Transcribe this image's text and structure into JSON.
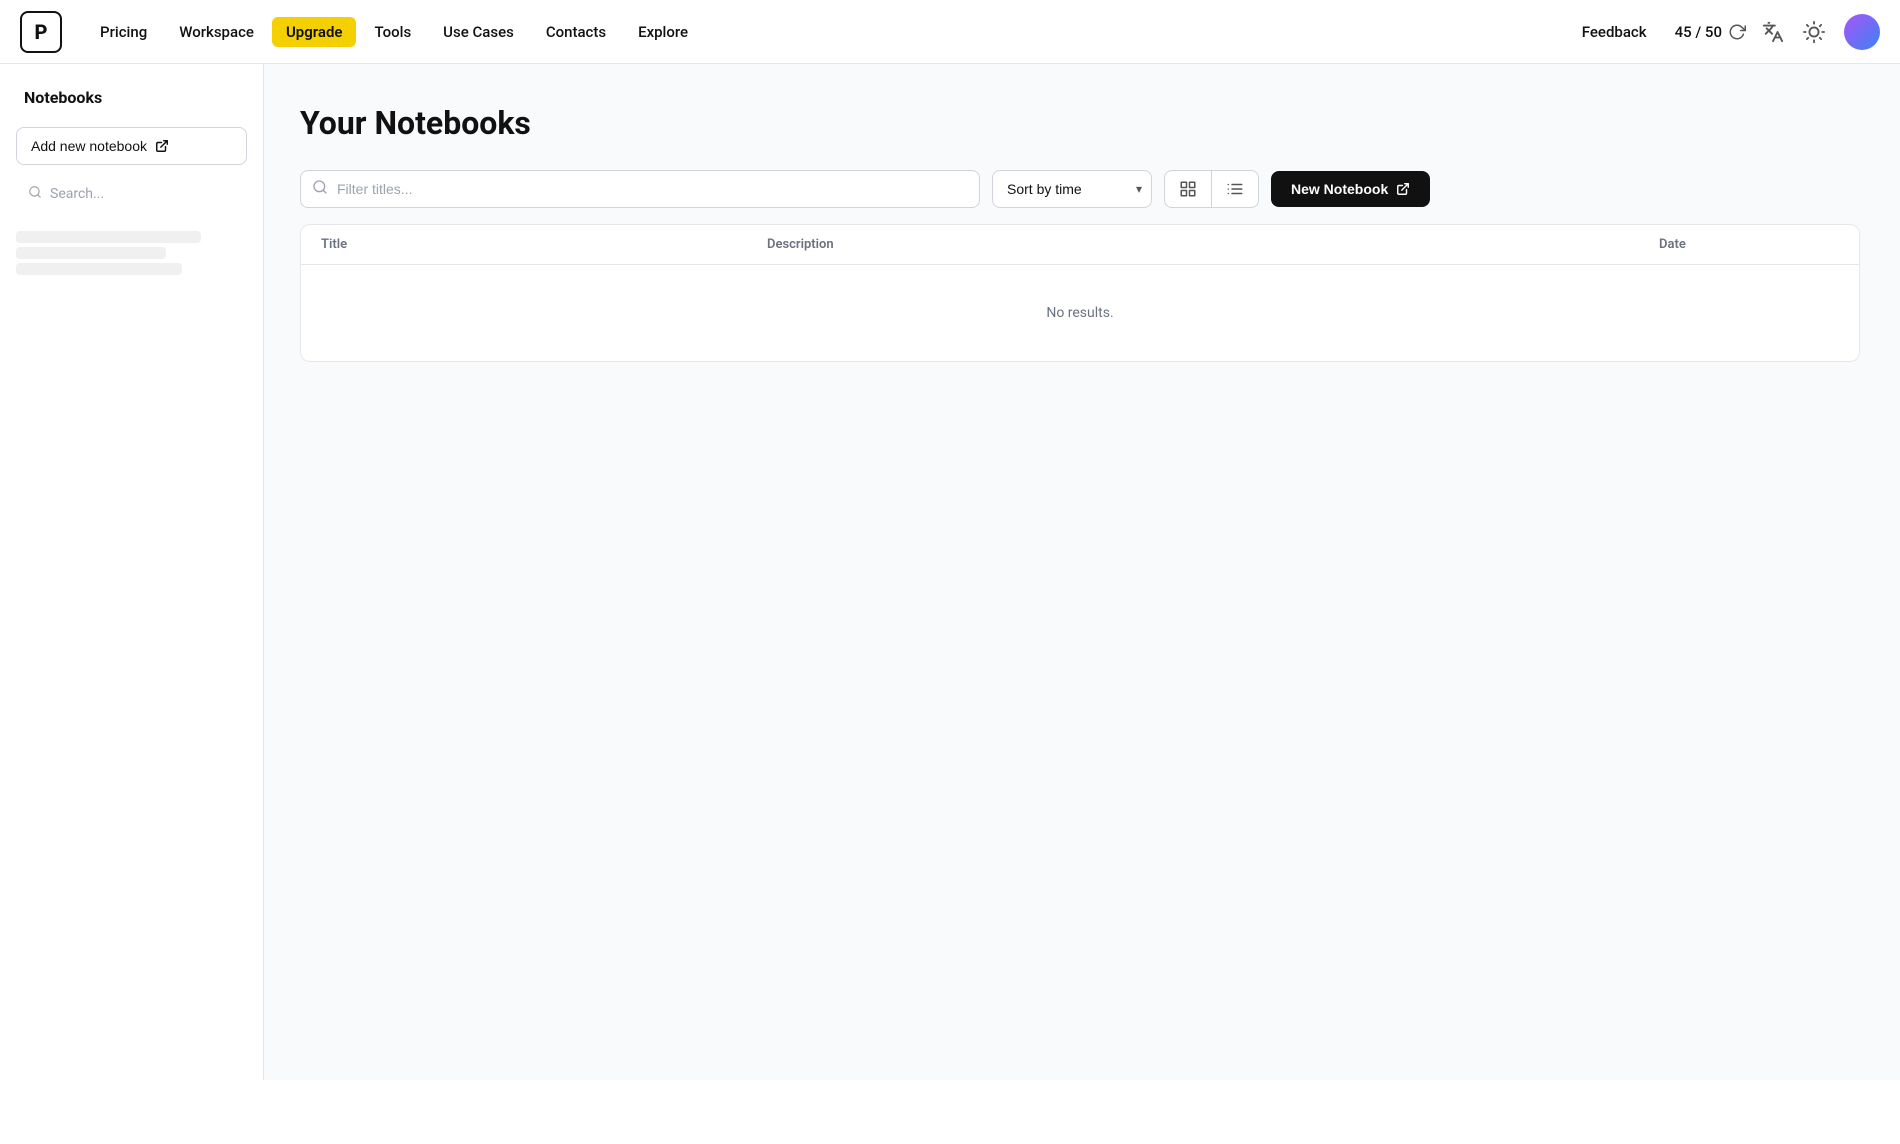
{
  "header": {
    "logo_letter": "P",
    "nav": {
      "pricing": "Pricing",
      "workspace": "Workspace",
      "upgrade": "Upgrade",
      "tools": "Tools",
      "use_cases": "Use Cases",
      "contacts": "Contacts",
      "explore": "Explore"
    },
    "feedback": "Feedback",
    "usage": "45 / 50"
  },
  "sidebar": {
    "title": "Notebooks",
    "add_notebook": "Add new notebook",
    "search_placeholder": "Search..."
  },
  "main": {
    "page_title": "Your Notebooks",
    "filter_placeholder": "Filter titles...",
    "sort_label": "Sort by time",
    "new_notebook_label": "New Notebook",
    "table": {
      "columns": [
        "Title",
        "Description",
        "Date"
      ],
      "no_results": "No results."
    }
  }
}
